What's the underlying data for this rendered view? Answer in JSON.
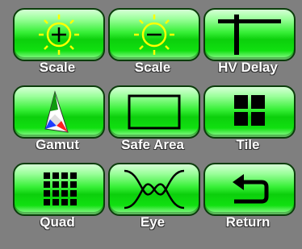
{
  "buttons": [
    {
      "label": "Scale",
      "icon": "sun-plus-icon"
    },
    {
      "label": "Scale",
      "icon": "sun-minus-icon"
    },
    {
      "label": "HV Delay",
      "icon": "crosshair-t-icon"
    },
    {
      "label": "Gamut",
      "icon": "color-gamut-icon"
    },
    {
      "label": "Safe Area",
      "icon": "rectangle-outline-icon"
    },
    {
      "label": "Tile",
      "icon": "tile-2x2-icon"
    },
    {
      "label": "Quad",
      "icon": "grid-4x4-icon"
    },
    {
      "label": "Eye",
      "icon": "eye-pattern-icon"
    },
    {
      "label": "Return",
      "icon": "return-arrow-icon"
    }
  ],
  "colors": {
    "background": "#7f7f7f",
    "button_green": "#10e010",
    "icon_yellow": "#ffff00",
    "label_white": "#ffffff"
  }
}
